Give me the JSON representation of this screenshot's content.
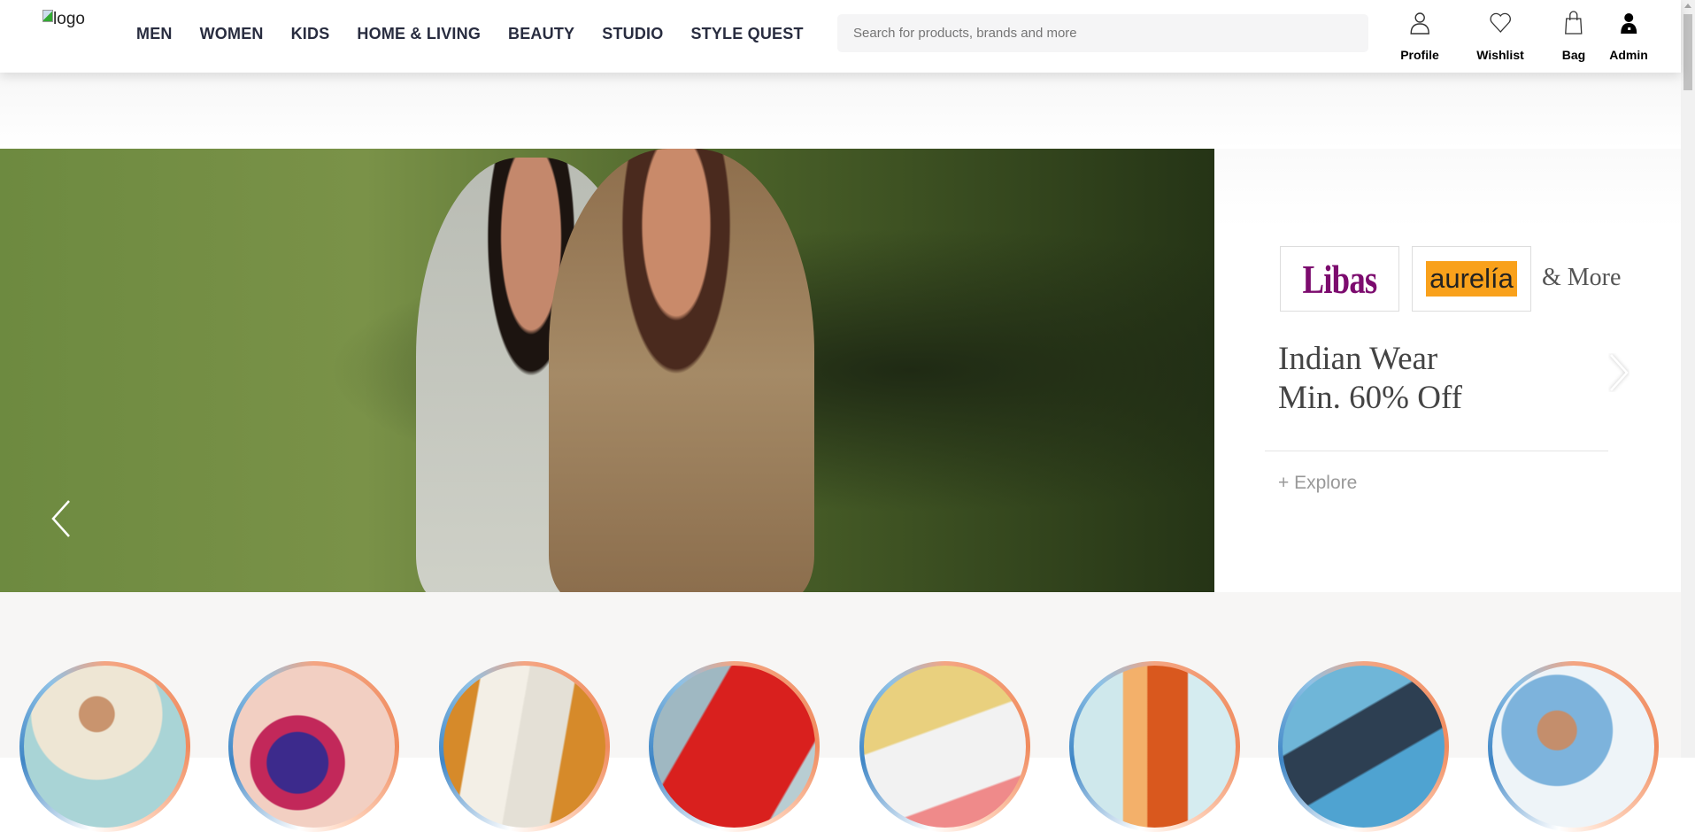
{
  "header": {
    "logo_alt": "logo",
    "nav": [
      "MEN",
      "WOMEN",
      "KIDS",
      "HOME & LIVING",
      "BEAUTY",
      "STUDIO",
      "STYLE QUEST"
    ],
    "search_placeholder": "Search for products, brands and more",
    "actions": [
      {
        "label": "Profile",
        "icon": "person-outline-icon"
      },
      {
        "label": "Wishlist",
        "icon": "heart-outline-icon"
      },
      {
        "label": "Bag",
        "icon": "shopping-bag-icon"
      },
      {
        "label": "Admin",
        "icon": "admin-user-icon"
      }
    ]
  },
  "banner": {
    "slide_count": 9,
    "active_slide": 2,
    "brands": [
      "Libas",
      "aurelía"
    ],
    "brands_suffix": "& More",
    "headline_1": "Indian Wear",
    "headline_2": "Min. 60% Off",
    "cta": "+ Explore",
    "colors": {
      "libas": "#7c0b6e",
      "aurelia_bg": "#f9a11b"
    }
  },
  "categories_count": 8
}
